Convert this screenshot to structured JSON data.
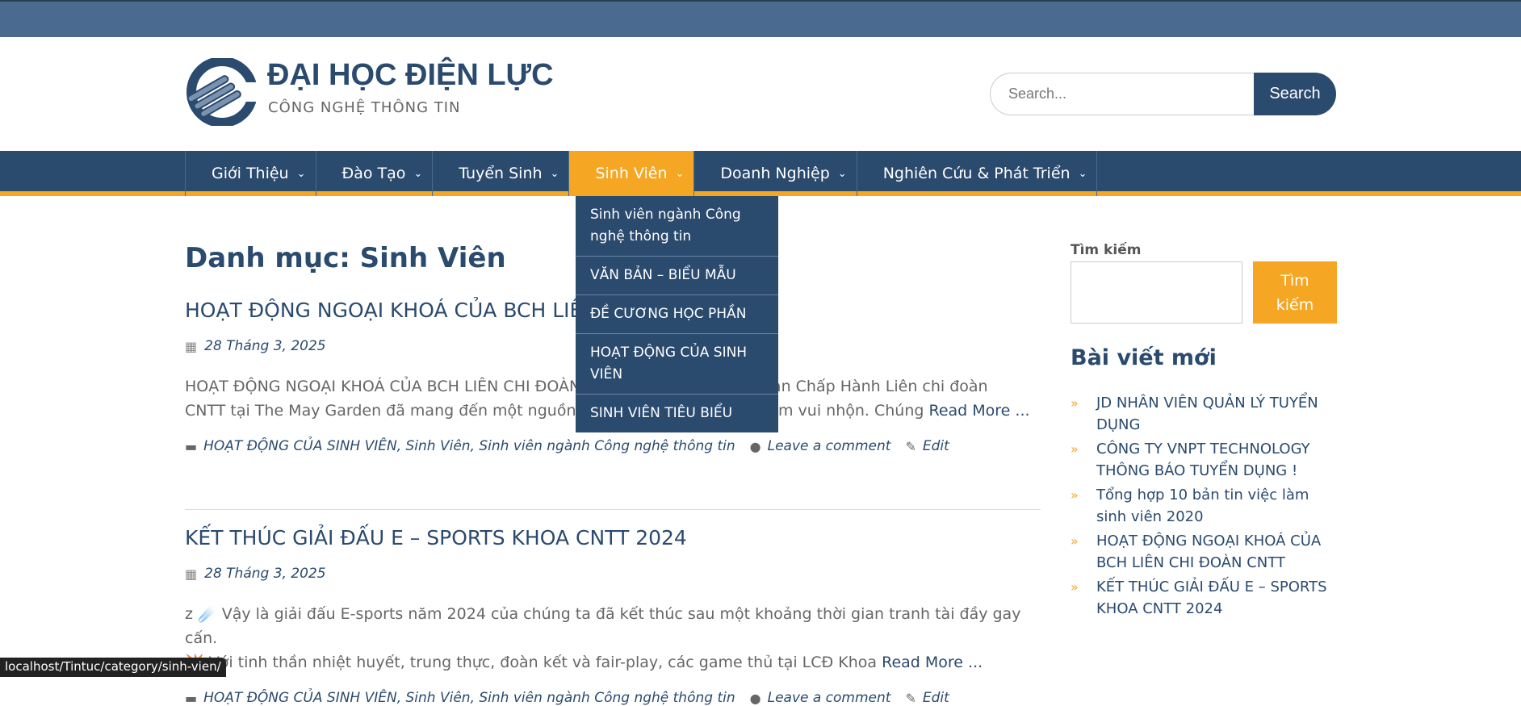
{
  "header": {
    "site_title": "ĐẠI HỌC ĐIỆN LỰC",
    "site_description": "CÔNG NGHỆ THÔNG TIN",
    "search_placeholder": "Search...",
    "search_button": "Search"
  },
  "nav": {
    "items": [
      {
        "label": "Giới Thiệu"
      },
      {
        "label": "Đào Tạo"
      },
      {
        "label": "Tuyển Sinh"
      },
      {
        "label": "Sinh Viên"
      },
      {
        "label": "Doanh Nghiệp"
      },
      {
        "label": "Nghiên Cứu & Phát Triển"
      }
    ],
    "dropdown": [
      "Sinh viên ngành Công nghệ thông tin",
      "VĂN BẢN – BIỂU MẪU",
      "ĐỀ CƯƠNG HỌC PHẦN",
      "HOẠT ĐỘNG CỦA SINH VIÊN",
      "SINH VIÊN TIÊU BIỂU"
    ]
  },
  "main": {
    "page_title": "Danh mục: Sinh Viên",
    "posts": [
      {
        "title": "HOẠT ĐỘNG NGOẠI KHOÁ CỦA BCH LIÊN",
        "date": "28 Tháng 3, 2025",
        "excerpt_1": "HOẠT ĐỘNG NGOẠI KHOÁ CỦA BCH LIÊN CHI ĐOÀN ",
        "excerpt_1b": "a Ban Chấp Hành Liên chi đoàn",
        "excerpt_2": "CNTT tại The May Garden đã mang đến một nguồn n",
        "excerpt_2b": "i nghiệm vui nhộn. Chúng ",
        "read_more": "Read More ...",
        "categories": "HOẠT ĐỘNG CỦA SINH VIÊN, Sinh Viên, Sinh viên ngành Công nghệ thông tin",
        "comment": "Leave a comment",
        "edit": "Edit"
      },
      {
        "title": "KẾT THÚC GIẢI ĐẤU E – SPORTS KHOA CNTT 2024",
        "date": "28 Tháng 3, 2025",
        "excerpt_1": "z ☄️ Vậy là giải đấu E-sports năm 2024 của chúng ta đã kết thúc sau một khoảng thời gian tranh tài đầy gay cấn.",
        "excerpt_2": "💥 Với tinh thần nhiệt huyết, trung thực, đoàn kết và fair-play, các game thủ tại LCĐ Khoa ",
        "read_more": "Read More ...",
        "categories": "HOẠT ĐỘNG CỦA SINH VIÊN, Sinh Viên, Sinh viên ngành Công nghệ thông tin",
        "comment": "Leave a comment",
        "edit": "Edit"
      }
    ]
  },
  "sidebar": {
    "search_label": "Tìm kiếm",
    "search_button": "Tìm kiếm",
    "recent_heading": "Bài viết mới",
    "recent_posts": [
      "JD NHÂN VIÊN QUẢN LÝ TUYỂN DỤNG",
      "CÔNG TY VNPT TECHNOLOGY THÔNG BÁO TUYỂN DỤNG !",
      "Tổng hợp 10 bản tin việc làm sinh viên 2020",
      "HOẠT ĐỘNG NGOẠI KHOÁ CỦA BCH LIÊN CHI ĐOÀN CNTT",
      "KẾT THÚC GIẢI ĐẤU E – SPORTS KHOA CNTT 2024"
    ]
  },
  "status_bar": "localhost/Tintuc/category/sinh-vien/",
  "colors": {
    "primary": "#2a4a6e",
    "accent": "#f5a623",
    "topbar": "#4a6a8f"
  }
}
